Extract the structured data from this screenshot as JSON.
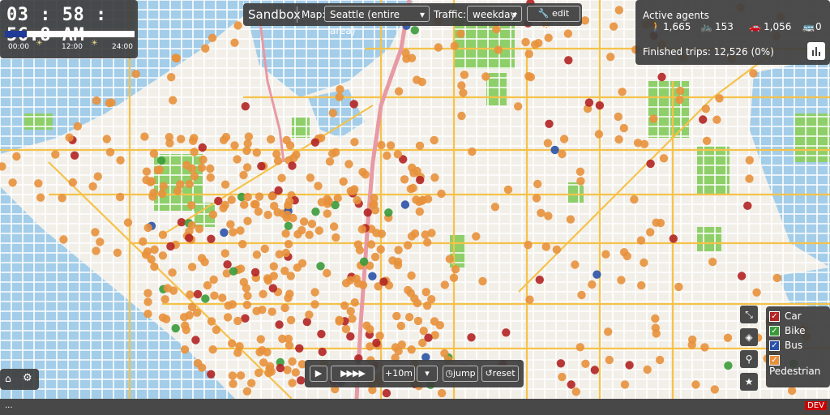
{
  "clock": {
    "time": "03 : 58 : 56.8 AM",
    "progress": 0.166,
    "ticks": [
      "00:00",
      "12:00",
      "24:00"
    ],
    "progress_color": "#1f3b99"
  },
  "topbar": {
    "title": "Sandbox",
    "map_label": "Map:",
    "map_value": "Seattle (entire area)",
    "traffic_label": "Traffic:",
    "traffic_value": "weekday",
    "edit_label": "edit map"
  },
  "agents": {
    "heading": "Active agents",
    "walk": "1,665",
    "bike": "153",
    "car": "1,056",
    "bus": "0",
    "finished": "Finished trips: 12,526 (0%)"
  },
  "speed": {
    "step": "+10m",
    "jump": "jump",
    "reset": "reset"
  },
  "legend": {
    "items": [
      {
        "label": "Car",
        "color": "#b32424"
      },
      {
        "label": "Bike",
        "color": "#3a9a3a"
      },
      {
        "label": "Bus",
        "color": "#2a52a8"
      },
      {
        "label": "Pedestrian",
        "color": "#e8913c"
      }
    ]
  },
  "bottom": {
    "dots": "...",
    "dev": "DEV"
  },
  "colors": {
    "water": "#a3cde8",
    "park": "#8fcf6a",
    "land": "#f2efe9",
    "road": "#ffffff",
    "arterial": "#f5c24a",
    "highway": "#e79aa4"
  }
}
